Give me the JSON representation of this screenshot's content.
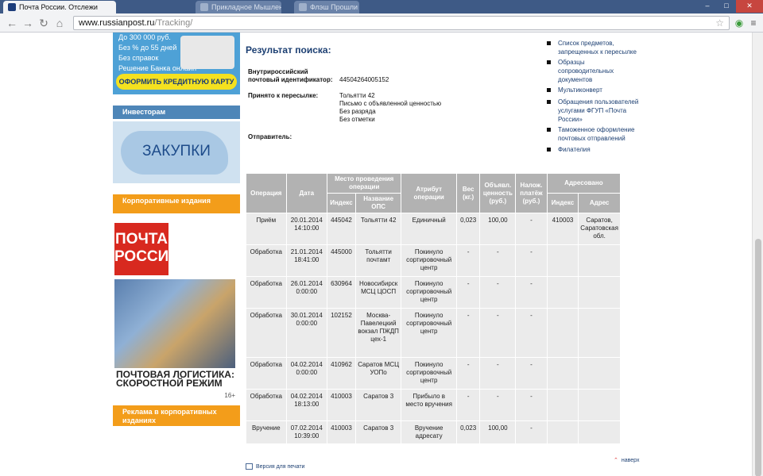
{
  "browser": {
    "tabs": [
      {
        "title": "Почта России. Отслежи"
      },
      {
        "title": "Прикладное Мышление"
      },
      {
        "title": "Флэш Прошли"
      },
      {
        "title": "Флэш Прошли"
      }
    ],
    "url_host": "www.russianpost.ru",
    "url_path": "/Tracking/"
  },
  "sidebar": {
    "credit_lines": [
      "До 300 000 руб.",
      "Без % до 55 дней",
      "Без справок",
      "Решение Банка онлайн"
    ],
    "credit_button": "ОФОРМИТЬ КРЕДИТНУЮ КАРТУ",
    "investors": "Инвесторам",
    "zakupki": "ЗАКУПКИ",
    "corp_editions": "Корпоративные издания",
    "magazine": {
      "logo_line1": "ПОЧТА",
      "logo_line2": "РОССИИ",
      "title": "ПОЧТОВАЯ ЛОГИСТИКА: СКОРОСТНОЙ РЕЖИМ",
      "age": "16+"
    },
    "corp_ads": "Реклама в корпоративных изданиях"
  },
  "main": {
    "result_title": "Результат поиска:",
    "id_label": "Внутрироссийский почтовый идентификатор:",
    "id_value": "44504264005152",
    "accepted_label": "Принято к пересылке:",
    "accepted_lines": [
      "Тольятти 42",
      "Письмо с объявленной ценностью",
      "Без разряда",
      "Без отметки"
    ],
    "sender_label": "Отправитель:"
  },
  "right_links": [
    "Список предметов, запрещенных к пересылке",
    "Образцы сопроводительных документов",
    "Мультиконверт",
    "Обращения пользователей услугами ФГУП «Почта России»",
    "Таможенное оформление почтовых отправлений",
    "Филателия"
  ],
  "table": {
    "headers": {
      "operation": "Операция",
      "date": "Дата",
      "place": "Место проведения операции",
      "index": "Индекс",
      "place_name": "Название ОПС",
      "attribute": "Атрибут операции",
      "weight": "Вес (кг.)",
      "declared": "Объявл. ценность (руб.)",
      "cod": "Налож. платёж (руб.)",
      "addressed": "Адресовано",
      "addr_index": "Индекс",
      "addr": "Адрес"
    },
    "rows": [
      {
        "op": "Приём",
        "date": "20.01.2014 14:10:00",
        "index": "445042",
        "name": "Тольятти 42",
        "attr": "Единичный",
        "weight": "0,023",
        "value": "100,00",
        "cod": "-",
        "aindex": "410003",
        "addr": "Саратов, Саратовская обл."
      },
      {
        "op": "Обработка",
        "date": "21.01.2014 18:41:00",
        "index": "445000",
        "name": "Тольятти почтамт",
        "attr": "Покинуло сортировочный центр",
        "weight": "-",
        "value": "-",
        "cod": "-",
        "aindex": "",
        "addr": ""
      },
      {
        "op": "Обработка",
        "date": "26.01.2014 0:00:00",
        "index": "630964",
        "name": "Новосибирск МСЦ ЦОСП",
        "attr": "Покинуло сортировочный центр",
        "weight": "-",
        "value": "-",
        "cod": "-",
        "aindex": "",
        "addr": ""
      },
      {
        "op": "Обработка",
        "date": "30.01.2014 0:00:00",
        "index": "102152",
        "name": "Москва-Павелецкий вокзал ПЖДП цех-1",
        "attr": "Покинуло сортировочный центр",
        "weight": "-",
        "value": "-",
        "cod": "-",
        "aindex": "",
        "addr": ""
      },
      {
        "op": "Обработка",
        "date": "04.02.2014 0:00:00",
        "index": "410962",
        "name": "Саратов МСЦ УОПо",
        "attr": "Покинуло сортировочный центр",
        "weight": "-",
        "value": "-",
        "cod": "-",
        "aindex": "",
        "addr": ""
      },
      {
        "op": "Обработка",
        "date": "04.02.2014 18:13:00",
        "index": "410003",
        "name": "Саратов 3",
        "attr": "Прибыло в место вручения",
        "weight": "-",
        "value": "-",
        "cod": "-",
        "aindex": "",
        "addr": ""
      },
      {
        "op": "Вручение",
        "date": "07.02.2014 10:39:00",
        "index": "410003",
        "name": "Саратов 3",
        "attr": "Вручение адресату",
        "weight": "0,023",
        "value": "100,00",
        "cod": "-",
        "aindex": "",
        "addr": ""
      }
    ]
  },
  "footer": {
    "print": "Версия для печати",
    "up": "наверх"
  }
}
